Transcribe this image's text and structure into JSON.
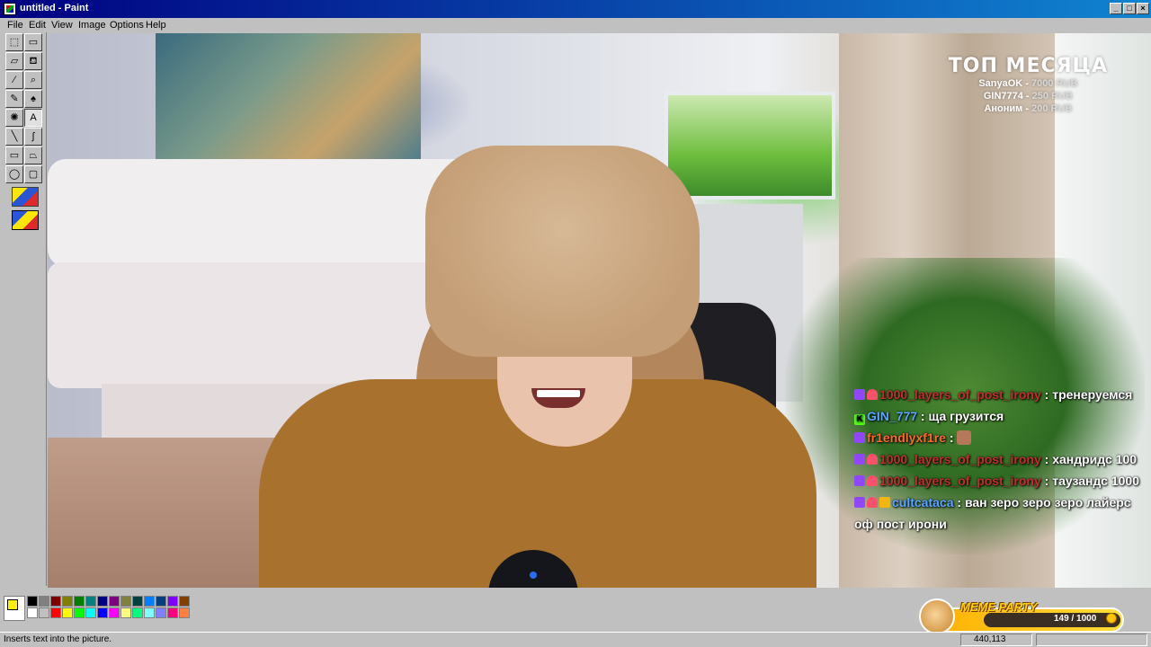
{
  "window": {
    "title": "untitled - Paint",
    "controls": [
      "_",
      "□",
      "×"
    ]
  },
  "menu": [
    "File",
    "Edit",
    "View",
    "Image",
    "Options",
    "Help"
  ],
  "toolbox": {
    "tools": [
      {
        "name": "free-form-select-icon",
        "glyph": "⬚"
      },
      {
        "name": "select-icon",
        "glyph": "▭"
      },
      {
        "name": "eraser-icon",
        "glyph": "▱"
      },
      {
        "name": "fill-bucket-icon",
        "glyph": "⛾"
      },
      {
        "name": "pick-color-icon",
        "glyph": "⁄"
      },
      {
        "name": "magnifier-icon",
        "glyph": "⌕"
      },
      {
        "name": "pencil-icon",
        "glyph": "✎"
      },
      {
        "name": "brush-icon",
        "glyph": "♠"
      },
      {
        "name": "airbrush-icon",
        "glyph": "✺"
      },
      {
        "name": "text-icon",
        "glyph": "A"
      },
      {
        "name": "line-icon",
        "glyph": "╲"
      },
      {
        "name": "curve-icon",
        "glyph": "∫"
      },
      {
        "name": "rectangle-icon",
        "glyph": "▭"
      },
      {
        "name": "polygon-icon",
        "glyph": "⏢"
      },
      {
        "name": "ellipse-icon",
        "glyph": "◯"
      },
      {
        "name": "rounded-rectangle-icon",
        "glyph": "▢"
      }
    ],
    "active_tool": "text-icon"
  },
  "overlay": {
    "top_month": {
      "title": "ТОП МЕСЯЦА",
      "rows": [
        {
          "name": "SanyaOK",
          "amount": "7000 RUB"
        },
        {
          "name": "GIN7774",
          "amount": "250 RUB"
        },
        {
          "name": "Аноним",
          "amount": "200 RUB"
        }
      ]
    },
    "chat": [
      {
        "badges": [
          "twitch",
          "heart"
        ],
        "user": "1000_layers_of_post_irony",
        "color": "red",
        "text": "тренеруемся"
      },
      {
        "badges": [
          "kick"
        ],
        "user": "GIN_777",
        "color": "blue",
        "text": "ща грузится"
      },
      {
        "badges": [
          "twitch"
        ],
        "user": "fr1endlyxf1re",
        "color": "orange",
        "text": "",
        "emote": "avatar"
      },
      {
        "badges": [
          "twitch",
          "heart"
        ],
        "user": "1000_layers_of_post_irony",
        "color": "red",
        "text": "хандридс 100"
      },
      {
        "badges": [
          "twitch",
          "heart"
        ],
        "user": "1000_layers_of_post_irony",
        "color": "red",
        "text": "таузандс 1000"
      },
      {
        "badges": [
          "twitch",
          "heart",
          "crown"
        ],
        "user": "cultcataca",
        "color": "blue",
        "text": "ван зеро зеро зеро лайерс оф пост ирони"
      }
    ],
    "meme_party": {
      "title": "MEME PARTY",
      "count": "149 / 1000",
      "progress": 0.149
    }
  },
  "palette": {
    "foreground": "#fff200",
    "background": "#ffffff",
    "top": [
      "#000000",
      "#808080",
      "#800000",
      "#808000",
      "#008000",
      "#008080",
      "#000080",
      "#800080",
      "#808040",
      "#004040",
      "#0080ff",
      "#004080",
      "#8000ff",
      "#804000"
    ],
    "bottom": [
      "#ffffff",
      "#c0c0c0",
      "#ff0000",
      "#ffff00",
      "#00ff00",
      "#00ffff",
      "#0000ff",
      "#ff00ff",
      "#ffff80",
      "#00ff80",
      "#80ffff",
      "#8080ff",
      "#ff0080",
      "#ff8040"
    ]
  },
  "status": {
    "text": "Inserts text into the picture.",
    "coords": "440,113",
    "size": ""
  }
}
